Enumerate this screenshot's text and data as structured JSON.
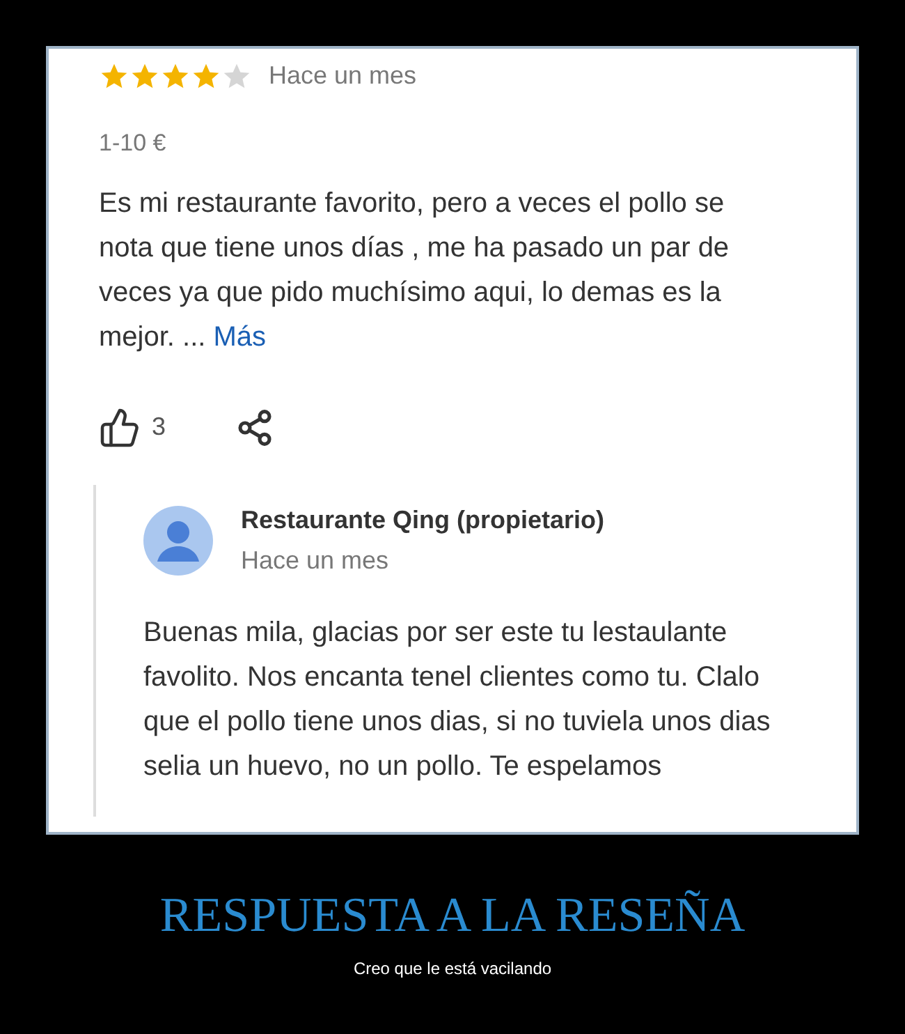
{
  "review": {
    "stars": 4,
    "time": "Hace un mes",
    "price": "1-10 €",
    "text": "Es mi restaurante favorito, pero a veces el pollo se nota que tiene unos días , me ha pasado un par de veces ya que pido muchísimo aqui, lo demas es la mejor. ...",
    "more_link": "Más",
    "likes": "3"
  },
  "reply": {
    "author": "Restaurante Qing (propietario)",
    "time": "Hace un mes",
    "text": "Buenas mila, glacias por ser este tu lestaulante favolito. Nos encanta tenel clientes como tu. Clalo que el pollo tiene unos dias, si no tuviela unos dias selia un huevo, no un pollo. Te espelamos"
  },
  "title": "RESPUESTA A LA RESEÑA",
  "subtitle": "Creo que le está vacilando"
}
